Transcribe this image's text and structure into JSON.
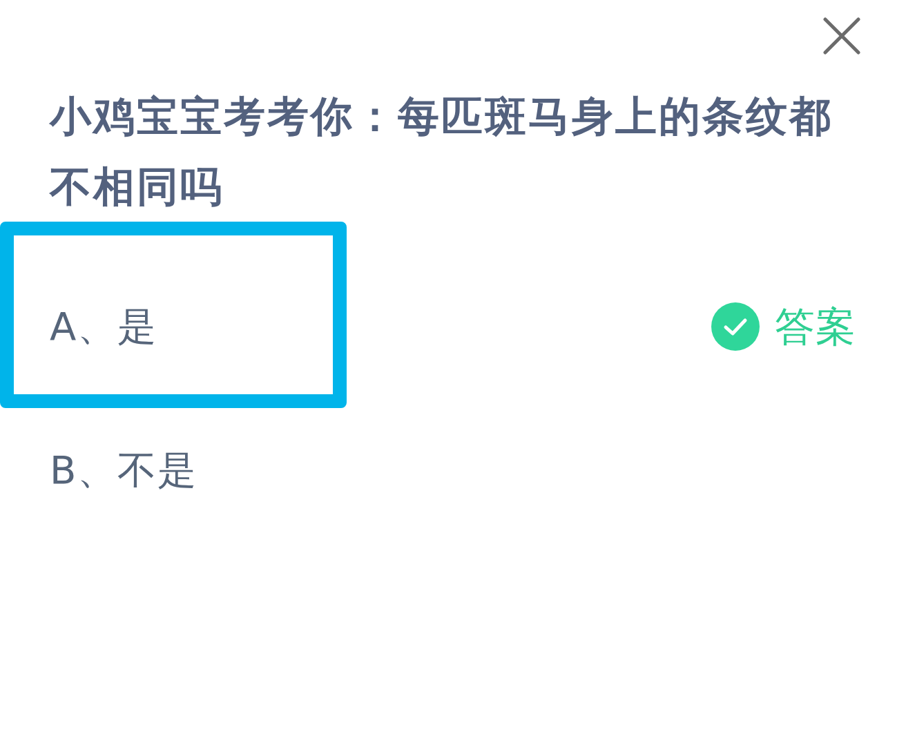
{
  "question": {
    "title": "小鸡宝宝考考你：每匹斑马身上的条纹都不相同吗"
  },
  "options": [
    {
      "label": "A、是",
      "selected": true,
      "correct": true
    },
    {
      "label": "B、不是",
      "selected": false,
      "correct": false
    }
  ],
  "answer_label": "答案"
}
